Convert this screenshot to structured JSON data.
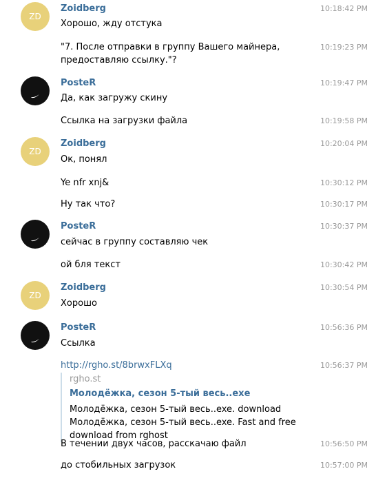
{
  "participants": {
    "zoidberg": {
      "name": "Zoidberg",
      "initials": "ZD",
      "avatar_color": "#e8d17a"
    },
    "poster": {
      "name": "PosteR",
      "avatar_color": "#111111",
      "avatar_icon": "nike-swoosh-icon"
    }
  },
  "messages": [
    {
      "text": "Хорошо, жду отстука",
      "time": "10:18:42 PM"
    },
    {
      "text": "\"7. После отправки в группу Вашего майнера, предоставляю ссылку.\"?",
      "time": "10:19:23 PM"
    },
    {
      "text": "Да, как загружу скину",
      "time": "10:19:47 PM"
    },
    {
      "text": "Ссылка на загрузки файла",
      "time": "10:19:58 PM"
    },
    {
      "text": "Ок, понял",
      "time": "10:20:04 PM"
    },
    {
      "text": "Ye nfr xnj&",
      "time": "10:30:12 PM"
    },
    {
      "text": "Ну так что?",
      "time": "10:30:17 PM"
    },
    {
      "text": "сейчас в группу составляю чек",
      "time": "10:30:37 PM"
    },
    {
      "text": "ой бля текст",
      "time": "10:30:42 PM"
    },
    {
      "text": "Хорошо",
      "time": "10:30:54 PM"
    },
    {
      "text": "Ссылка",
      "time": "10:56:36 PM"
    },
    {
      "text": "http://rgho.st/8brwxFLXq",
      "time": "10:56:37 PM"
    },
    {
      "text": "В течении двух часов, расскачаю файл",
      "time": "10:56:50 PM"
    },
    {
      "text": "до стобильных загрузок",
      "time": "10:57:00 PM"
    }
  ],
  "link_preview": {
    "site": "rgho.st",
    "title": "Молодёжка, сезон 5-тый весь..exe",
    "description": "Молодёжка, сезон 5-тый весь..exe. download Молодёжка, сезон 5-тый весь..exe. Fast and free download from rghost"
  }
}
